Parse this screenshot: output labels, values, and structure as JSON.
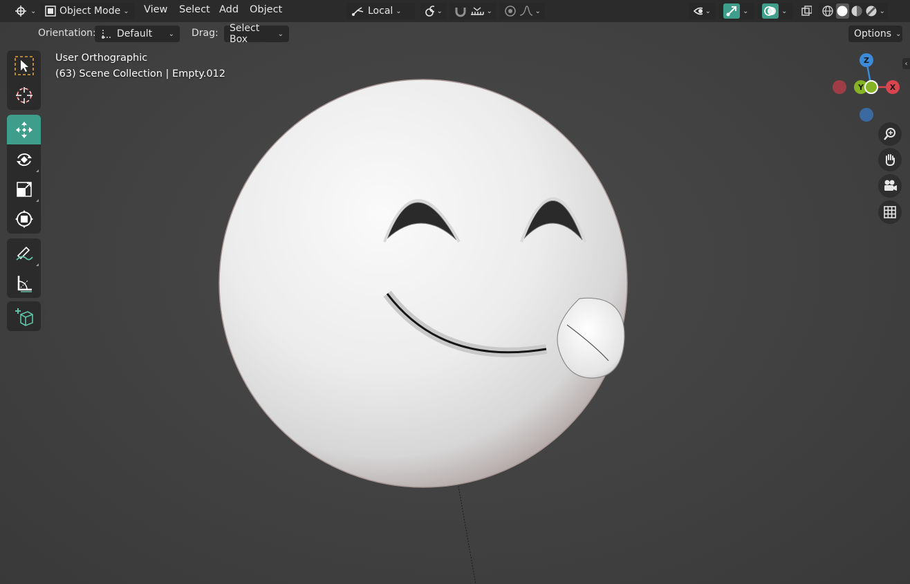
{
  "header": {
    "editor_icon": "viewport-editor-icon",
    "mode": "Object Mode",
    "menus": [
      "View",
      "Select",
      "Add",
      "Object"
    ],
    "transform_orientation": "Local",
    "options_label": "Options"
  },
  "tool_settings": {
    "orientation_label": "Orientation:",
    "orientation_value": "Default",
    "drag_label": "Drag:",
    "drag_value": "Select Box"
  },
  "overlay": {
    "view_name": "User Orthographic",
    "collection_info": "(63) Scene Collection | Empty.012"
  },
  "gizmo": {
    "z": "Z",
    "y": "Y",
    "x": "X"
  },
  "toolbox": [
    {
      "group": 1,
      "tools": [
        "select-box-icon",
        "cursor-icon"
      ]
    },
    {
      "group": 2,
      "tools": [
        "move-icon",
        "rotate-icon",
        "scale-icon",
        "transform-icon"
      ],
      "active": "move-icon"
    },
    {
      "group": 3,
      "tools": [
        "annotate-icon",
        "measure-icon"
      ]
    },
    {
      "group": 4,
      "tools": [
        "add-cube-icon"
      ]
    }
  ],
  "navigation": [
    "zoom-icon",
    "pan-hand-icon",
    "camera-icon",
    "grid-icon"
  ],
  "colors": {
    "accent": "#3f9e8b",
    "axis_x": "#d9444f",
    "axis_y": "#85b325",
    "axis_z": "#3d8ad9"
  }
}
